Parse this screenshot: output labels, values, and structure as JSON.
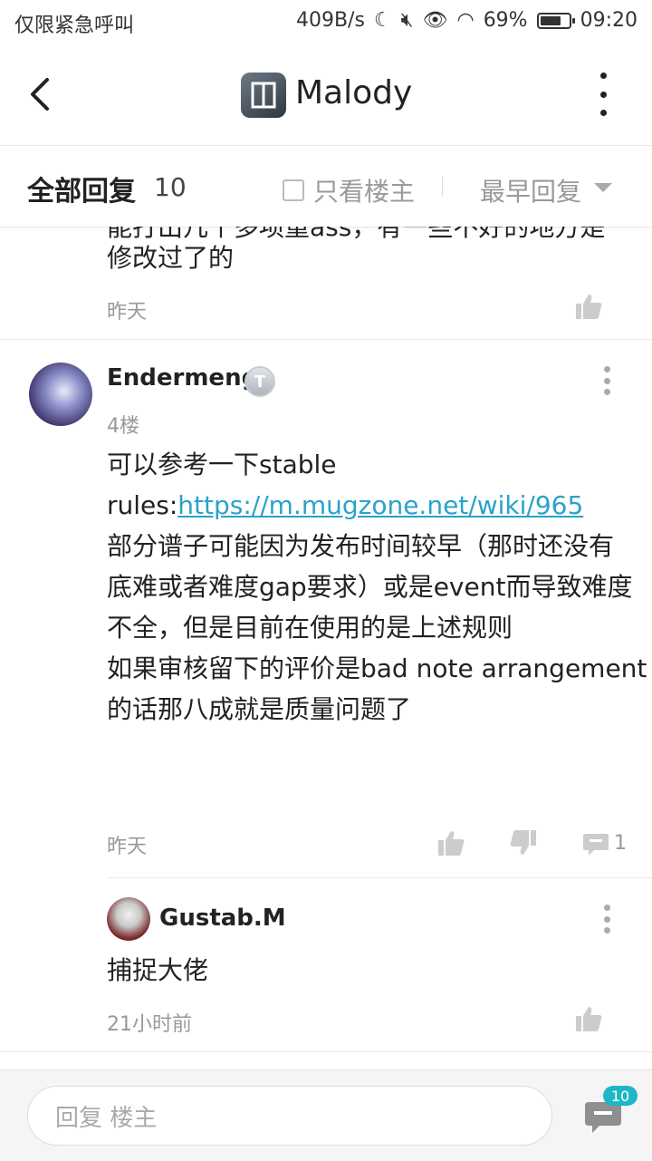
{
  "status_bar": {
    "left_text": "仅限紧急呼叫",
    "speed": "409B/s",
    "battery": "69%",
    "time": "09:20"
  },
  "header": {
    "title": "Malody"
  },
  "filter": {
    "all_replies": "全部回复",
    "count": "10",
    "only_owner": "只看楼主",
    "sort": "最早回复"
  },
  "prev_post": {
    "partial_line": "能打出几个多项重ass，有一些不好的地方是",
    "line": "修改过了的",
    "time": "昨天"
  },
  "post": {
    "author": "Endermeng",
    "badge": "T",
    "floor": "4楼",
    "line1": "可以参考一下stable",
    "line2_prefix": "rules:",
    "line2_link": "https://m.mugzone.net/wiki/965",
    "line3": "部分谱子可能因为发布时间较早（那时还没有",
    "line4": "底难或者难度gap要求）或是event而导致难度",
    "line5": "不全，但是目前在使用的是上述规则",
    "line6": "如果审核留下的评价是bad note arrangement",
    "line7": "的话那八成就是质量问题了",
    "time": "昨天",
    "comment_count": "1"
  },
  "sub_reply": {
    "author": "Gustab.M",
    "text": "捕捉大佬",
    "time": "21小时前"
  },
  "bottom": {
    "placeholder": "回复  楼主",
    "unread": "10"
  },
  "icons": {
    "accent": "#2aa3c8",
    "badge_color": "#1fb7c6"
  }
}
